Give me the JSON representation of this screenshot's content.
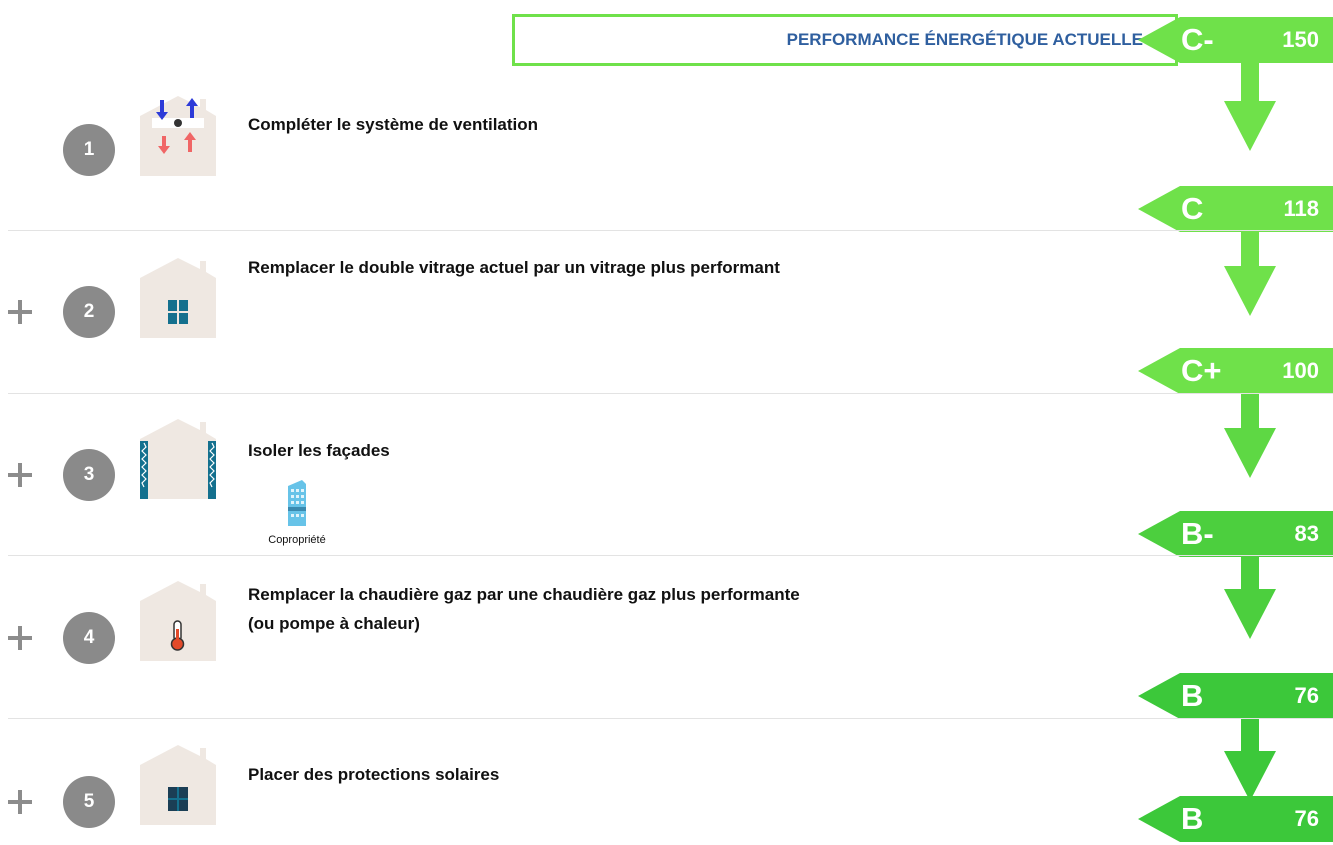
{
  "header": {
    "current_label": "PERFORMANCE ÉNERGÉTIQUE ACTUELLE",
    "border_color": "#6fe14a"
  },
  "badges": [
    {
      "letter": "C-",
      "value": "150",
      "color": "#6fe14a"
    },
    {
      "letter": "C",
      "value": "118",
      "color": "#6fe14a"
    },
    {
      "letter": "C+",
      "value": "100",
      "color": "#6fe14a"
    },
    {
      "letter": "B-",
      "value": "83",
      "color": "#4ccf3e"
    },
    {
      "letter": "B",
      "value": "76",
      "color": "#3cc83a"
    },
    {
      "letter": "B",
      "value": "76",
      "color": "#3cc83a"
    }
  ],
  "steps": [
    {
      "number": "1",
      "title": "Compléter le système de ventilation",
      "icon": "ventilation-icon"
    },
    {
      "number": "2",
      "title": "Remplacer le double vitrage actuel par un vitrage plus performant",
      "icon": "window-icon"
    },
    {
      "number": "3",
      "title": "Isoler les façades",
      "icon": "facade-insulation-icon",
      "tag": "Copropriété",
      "tag_icon": "building-icon"
    },
    {
      "number": "4",
      "title": "Remplacer la chaudière gaz par une chaudière gaz plus performante (ou pompe à chaleur)",
      "icon": "thermometer-icon"
    },
    {
      "number": "5",
      "title": "Placer des protections solaires",
      "icon": "solar-shade-icon"
    }
  ],
  "colors": {
    "step_circle": "#8a8a8a",
    "house_fill": "#efe8e2",
    "window": "#14708e",
    "shade": "#1b3e55",
    "title_blue": "#2f5f9f"
  }
}
